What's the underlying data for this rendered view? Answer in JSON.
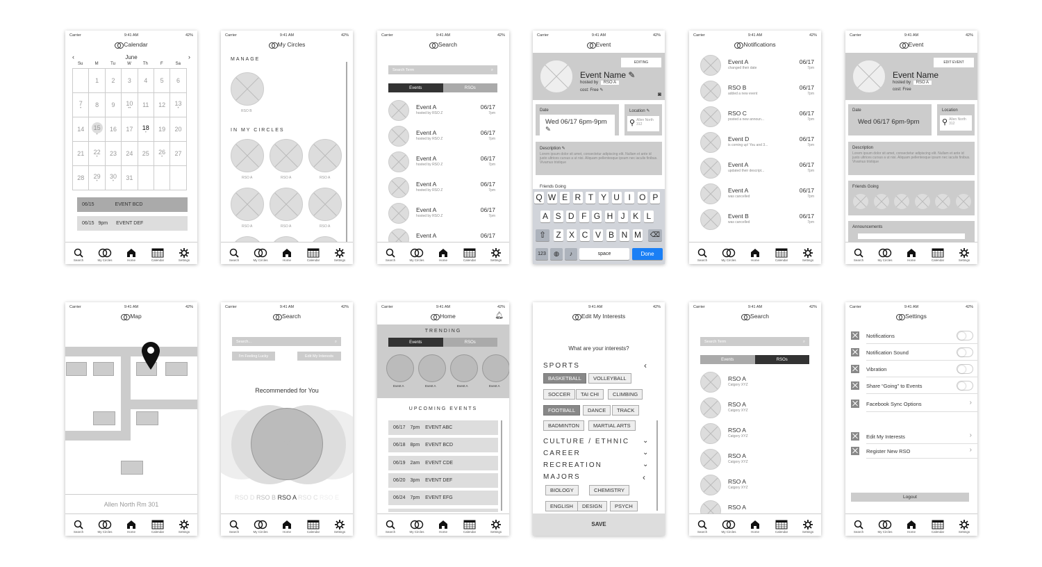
{
  "status": {
    "carrier": "Carrier",
    "time": "9:41 AM",
    "battery": "42%"
  },
  "tabs": [
    "Search",
    "My Circles",
    "Home",
    "Calendar",
    "Settings"
  ],
  "calendar": {
    "title": "Calendar",
    "month": "June",
    "weekdays": [
      "Su",
      "M",
      "Tu",
      "W",
      "Th",
      "F",
      "Sa"
    ],
    "weeks": [
      [
        "",
        "1",
        "2",
        "3",
        "4",
        "5",
        "6"
      ],
      [
        "7",
        "8",
        "9",
        "10",
        "11",
        "12",
        "13"
      ],
      [
        "14",
        "15",
        "16",
        "17",
        "18",
        "19",
        "20"
      ],
      [
        "21",
        "22",
        "23",
        "24",
        "25",
        "26",
        "27"
      ],
      [
        "28",
        "29",
        "30",
        "31",
        "",
        "",
        ""
      ]
    ],
    "events": [
      {
        "date": "06/15",
        "time": "",
        "name": "EVENT BCD"
      },
      {
        "date": "06/15",
        "time": "9pm",
        "name": "EVENT DEF"
      }
    ]
  },
  "circles": {
    "title": "My Circles",
    "manage": "MANAGE",
    "manage_item": "RSO B",
    "in_my_circles": "IN MY CIRCLES",
    "item": "RSO A"
  },
  "search1": {
    "title": "Search",
    "placeholder": "Search Term",
    "seg": [
      "Events",
      "RSOs"
    ],
    "rows": [
      {
        "name": "Event A",
        "sub": "hosted by RSO Z",
        "date": "06/17",
        "time": "7pm"
      }
    ]
  },
  "event_edit": {
    "title": "Event",
    "editing": "EDITING",
    "name": "Event Name",
    "hosted_by": "hosted by",
    "rso": "RSO A",
    "cost": "cost: Free",
    "date_label": "Date",
    "date_value": "Wed 06/17 6pm-9pm",
    "loc_label": "Location",
    "loc_value": "Allen North 312",
    "desc_label": "Description",
    "desc_text": "Lorem ipsum dolor sit amet, consectetur adipiscing elit. Nullam et ante id justo ultrices cursus a ut nisi. Aliquam pellentesque ipsum nec iaculis finibus. Vivamus tristique",
    "friends_label": "Friends Going",
    "keys": [
      [
        "Q",
        "W",
        "E",
        "R",
        "T",
        "Y",
        "U",
        "I",
        "O",
        "P"
      ],
      [
        "A",
        "S",
        "D",
        "F",
        "G",
        "H",
        "J",
        "K",
        "L"
      ],
      [
        "Z",
        "X",
        "C",
        "V",
        "B",
        "N",
        "M"
      ]
    ],
    "k123": "123",
    "space": "space",
    "done": "Done"
  },
  "notifications": {
    "title": "Notifications",
    "rows": [
      {
        "name": "Event A",
        "sub": "changed their date",
        "date": "06/17",
        "time": "7pm"
      },
      {
        "name": "RSO B",
        "sub": "added a new event",
        "date": "06/17",
        "time": "7pm"
      },
      {
        "name": "RSO C",
        "sub": "posted a new announ...",
        "date": "06/17",
        "time": "7pm"
      },
      {
        "name": "Event D",
        "sub": "is coming up! You and 3...",
        "date": "06/17",
        "time": "7pm"
      },
      {
        "name": "Event A",
        "sub": "updated their descript...",
        "date": "06/17",
        "time": "7pm"
      },
      {
        "name": "Event A",
        "sub": "was cancelled",
        "date": "06/17",
        "time": "7pm"
      },
      {
        "name": "Event B",
        "sub": "was cancelled",
        "date": "06/17",
        "time": "7pm"
      }
    ]
  },
  "event_view": {
    "title": "Event",
    "edit": "EDIT EVENT",
    "announcements": "Announcements"
  },
  "map": {
    "title": "Map",
    "location": "Allen North Rm 301"
  },
  "search2": {
    "title": "Search",
    "placeholder": "Search...",
    "lucky": "I'm Feeling Lucky",
    "edit": "Edit My Interests",
    "recommended": "Recommended for You",
    "carousel": [
      "RSO D",
      "RSO B",
      "RSO A",
      "RSO C",
      "RSO E"
    ]
  },
  "home": {
    "title": "Home",
    "trending": "TRENDING",
    "seg": [
      "Events",
      "RSOs"
    ],
    "event_label": "Event A",
    "upcoming": "UPCOMING EVENTS",
    "rows": [
      {
        "date": "06/17",
        "time": "7pm",
        "name": "EVENT ABC"
      },
      {
        "date": "06/18",
        "time": "8pm",
        "name": "EVENT BCD"
      },
      {
        "date": "06/19",
        "time": "2am",
        "name": "EVENT CDE"
      },
      {
        "date": "06/20",
        "time": "3pm",
        "name": "EVENT DEF"
      },
      {
        "date": "06/24",
        "time": "7pm",
        "name": "EVENT EFG"
      }
    ]
  },
  "interests": {
    "title": "Edit My Interests",
    "question": "What are your interests?",
    "sports": "SPORTS",
    "chips": [
      "BASKETBALL",
      "VOLLEYBALL",
      "SOCCER",
      "TAI CHI",
      "CLIMBING",
      "FOOTBALL",
      "DANCE",
      "TRACK",
      "BADMINTON",
      "MARTIAL ARTS"
    ],
    "cats": [
      "CULTURE / ETHNIC",
      "CAREER",
      "RECREATION",
      "MAJORS"
    ],
    "majors": [
      "BIOLOGY",
      "CHEMISTRY",
      "ENGLISH",
      "DESIGN",
      "PSYCH"
    ],
    "save": "SAVE"
  },
  "search3": {
    "title": "Search",
    "placeholder": "Search Term",
    "seg": [
      "Events",
      "RSOs"
    ],
    "row": {
      "name": "RSO A",
      "sub": "Catgory XYZ"
    }
  },
  "settings": {
    "title": "Settings",
    "items": [
      "Notifications",
      "Notification Sound",
      "Vibration",
      "Share “Going” to Events",
      "Facebook Sync Options"
    ],
    "items2": [
      "Edit My Interests",
      "Register New RSO"
    ],
    "logout": "Logout"
  },
  "colors": {
    "frame_bg": "#ffffff",
    "wire_gray": "#cccccc",
    "dark": "#333333",
    "done_blue": "#1a7ff5"
  }
}
